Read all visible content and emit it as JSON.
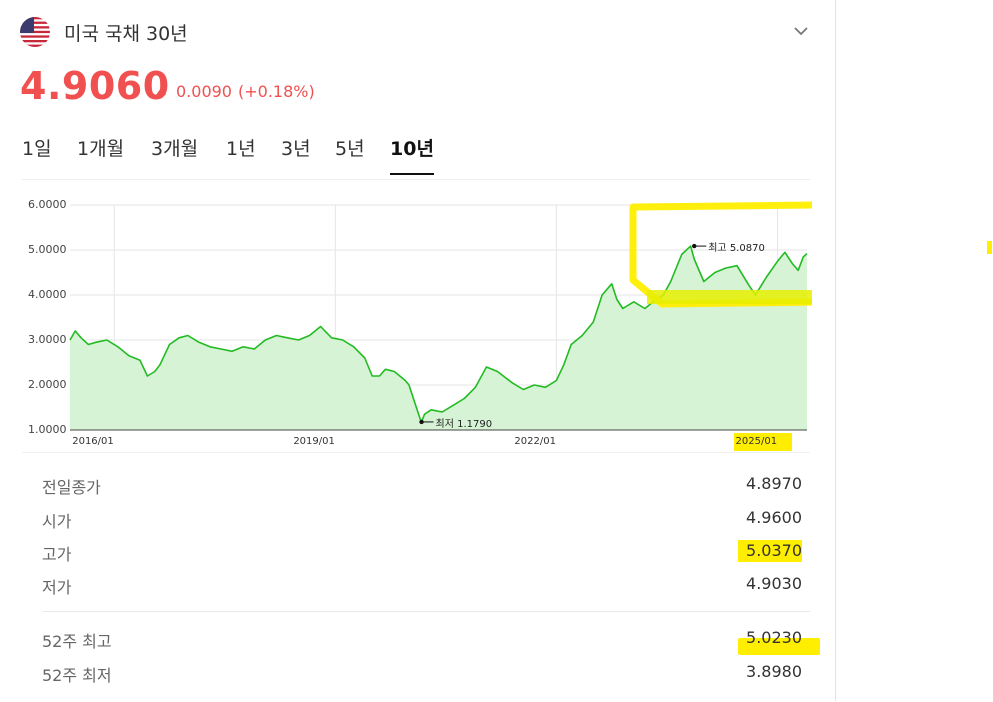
{
  "header": {
    "title": "미국 국채 30년",
    "flag_icon": "us-flag-icon",
    "expand_icon": "chevron-down-icon"
  },
  "quote": {
    "price": "4.9060",
    "change": "0.0090",
    "change_pct": "(+0.18%)",
    "direction": "up",
    "color": "#f05050"
  },
  "tabs": [
    {
      "label": "1일",
      "active": false
    },
    {
      "label": "1개월",
      "active": false
    },
    {
      "label": "3개월",
      "active": false
    },
    {
      "label": "1년",
      "active": false
    },
    {
      "label": "3년",
      "active": false
    },
    {
      "label": "5년",
      "active": false
    },
    {
      "label": "10년",
      "active": true
    }
  ],
  "chart_data": {
    "type": "area",
    "y_ticks": [
      "6.0000",
      "5.0000",
      "4.0000",
      "3.0000",
      "2.0000",
      "1.0000"
    ],
    "ylim": [
      1.0,
      6.0
    ],
    "x_ticks": [
      "2016/01",
      "2019/01",
      "2022/01",
      "2025/01"
    ],
    "xlim": [
      2015.4,
      2025.4
    ],
    "line_color": "#22bb22",
    "fill_color": "#d6f3d6",
    "grid": true,
    "series": [
      {
        "x": [
          2015.4,
          2015.47,
          2015.55,
          2015.65,
          2015.75,
          2015.9,
          2016.05,
          2016.2,
          2016.35,
          2016.45,
          2016.55,
          2016.62,
          2016.75,
          2016.88,
          2017.0,
          2017.15,
          2017.3,
          2017.45,
          2017.6,
          2017.75,
          2017.9,
          2018.05,
          2018.2,
          2018.35,
          2018.5,
          2018.65,
          2018.8,
          2018.95,
          2019.1,
          2019.25,
          2019.4,
          2019.5,
          2019.6,
          2019.68,
          2019.8,
          2019.95,
          2020.0,
          2020.08,
          2020.15,
          2020.17,
          2020.21,
          2020.3,
          2020.45,
          2020.6,
          2020.75,
          2020.9,
          2021.05,
          2021.2,
          2021.4,
          2021.55,
          2021.7,
          2021.85,
          2022.0,
          2022.1,
          2022.2,
          2022.35,
          2022.5,
          2022.62,
          2022.75,
          2022.82,
          2022.9,
          2023.05,
          2023.2,
          2023.35,
          2023.45,
          2023.55,
          2023.7,
          2023.82,
          2023.87,
          2024.0,
          2024.15,
          2024.3,
          2024.45,
          2024.6,
          2024.7,
          2024.85,
          2025.0,
          2025.1,
          2025.2,
          2025.28,
          2025.35,
          2025.4
        ],
        "y": [
          3.0,
          3.2,
          3.05,
          2.9,
          2.95,
          3.0,
          2.85,
          2.65,
          2.55,
          2.2,
          2.3,
          2.45,
          2.9,
          3.05,
          3.1,
          2.95,
          2.85,
          2.8,
          2.75,
          2.85,
          2.8,
          3.0,
          3.1,
          3.05,
          3.0,
          3.1,
          3.3,
          3.05,
          3.0,
          2.85,
          2.6,
          2.2,
          2.2,
          2.35,
          2.3,
          2.1,
          2.0,
          1.6,
          1.25,
          1.179,
          1.35,
          1.45,
          1.4,
          1.55,
          1.7,
          1.95,
          2.4,
          2.3,
          2.05,
          1.9,
          2.0,
          1.95,
          2.1,
          2.45,
          2.9,
          3.1,
          3.4,
          4.0,
          4.25,
          3.9,
          3.7,
          3.85,
          3.7,
          3.9,
          4.0,
          4.3,
          4.9,
          5.087,
          4.8,
          4.3,
          4.5,
          4.6,
          4.65,
          4.25,
          4.0,
          4.4,
          4.75,
          4.95,
          4.7,
          4.55,
          4.85,
          4.92
        ]
      }
    ],
    "annotations": [
      {
        "text": "최고 5.0870",
        "x": 2023.87,
        "y": 5.087
      },
      {
        "text": "최저 1.1790",
        "x": 2020.17,
        "y": 1.179
      }
    ]
  },
  "stats": [
    {
      "label": "전일종가",
      "value": "4.8970"
    },
    {
      "label": "시가",
      "value": "4.9600"
    },
    {
      "label": "고가",
      "value": "5.0370"
    },
    {
      "label": "저가",
      "value": "4.9030"
    },
    {
      "label": "52주 최고",
      "value": "5.0230"
    },
    {
      "label": "52주 최저",
      "value": "3.8980"
    }
  ],
  "highlight_color": "#ffee00"
}
